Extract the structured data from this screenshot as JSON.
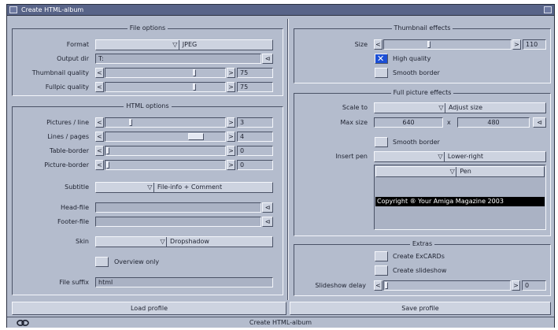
{
  "window": {
    "title": "Create HTML-album"
  },
  "file_options": {
    "heading": "File options",
    "format_label": "Format",
    "format_value": "JPEG",
    "output_dir_label": "Output dir",
    "output_dir_value": "T:",
    "thumb_quality_label": "Thumbnail quality",
    "thumb_quality_value": "75",
    "fullpic_quality_label": "Fullpic quality",
    "fullpic_quality_value": "75"
  },
  "html_options": {
    "heading": "HTML options",
    "pictures_line_label": "Pictures / line",
    "pictures_line_value": "3",
    "lines_page_label": "Lines / pages",
    "lines_page_value": "4",
    "table_border_label": "Table-border",
    "table_border_value": "0",
    "picture_border_label": "Picture-border",
    "picture_border_value": "0",
    "subtitle_label": "Subtitle",
    "subtitle_value": "File-info + Comment",
    "head_file_label": "Head-file",
    "footer_file_label": "Footer-file",
    "skin_label": "Skin",
    "skin_value": "Dropshadow",
    "overview_only_label": "Overview only",
    "file_suffix_label": "File suffix",
    "file_suffix_value": "html"
  },
  "thumbnail_effects": {
    "heading": "Thumbnail effects",
    "size_label": "Size",
    "size_value": "110",
    "high_quality_label": "High quality",
    "smooth_border_label": "Smooth border"
  },
  "full_picture_effects": {
    "heading": "Full picture effects",
    "scale_to_label": "Scale to",
    "scale_to_value": "Adjust size",
    "max_size_label": "Max size",
    "max_w": "640",
    "max_x": "x",
    "max_h": "480",
    "smooth_border_label": "Smooth border",
    "insert_pen_label": "Insert pen",
    "insert_pen_value": "Lower-right",
    "pen_label": "Pen",
    "copyright_text": "Copyright ® Your Amiga Magazine 2003"
  },
  "extras": {
    "heading": "Extras",
    "create_excards_label": "Create ExCARDs",
    "create_slideshow_label": "Create slideshow",
    "slideshow_delay_label": "Slideshow delay",
    "slideshow_delay_value": "0"
  },
  "buttons": {
    "load_profile": "Load profile",
    "save_profile": "Save profile"
  },
  "status": {
    "icon": "link-icon",
    "text": "Create HTML-album"
  },
  "glyphs": {
    "left": "<",
    "right": ">",
    "popup": "⊲",
    "cycle": "▽"
  },
  "sliders": {
    "thumb_quality": 0.75,
    "fullpic_quality": 0.75,
    "pictures_line": 0.2,
    "lines_page": 0.8,
    "table_border": 0.0,
    "picture_border": 0.0,
    "thumb_size": 0.35,
    "slideshow_delay": 0.0
  },
  "checks": {
    "thumb_high_quality": true,
    "thumb_smooth_border": false,
    "full_smooth_border": false,
    "overview_only": false,
    "create_excards": false,
    "create_slideshow": false
  },
  "colors": {
    "window_bg": "#b4bccd",
    "titlebar": "#586488",
    "checkbox_on": "#1c4fd6",
    "copyright_bar": "#000000"
  }
}
